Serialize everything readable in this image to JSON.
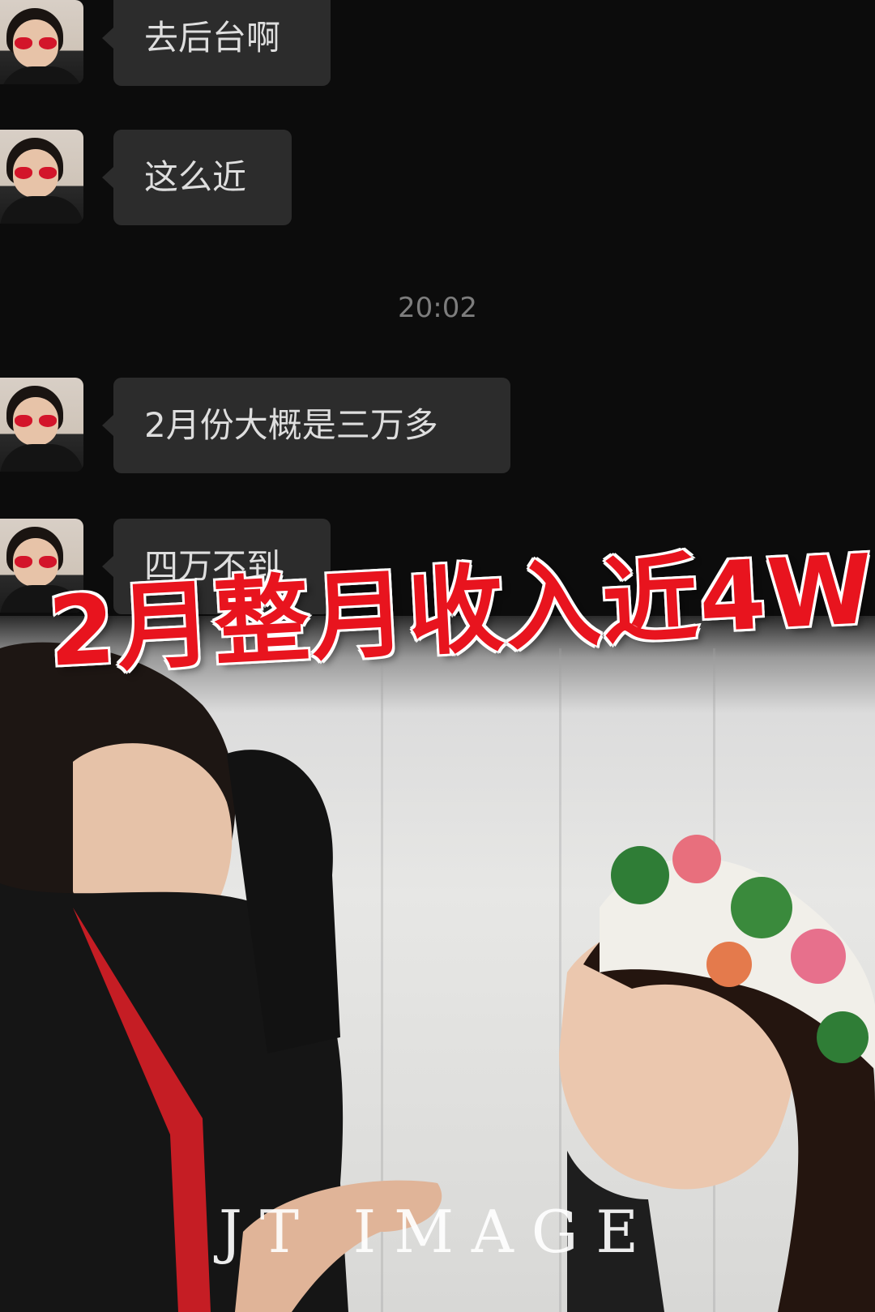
{
  "messages": [
    {
      "text": "去后台啊"
    },
    {
      "text": "这么近"
    },
    {
      "text": "2月份大概是三万多"
    },
    {
      "text": "四万不到"
    }
  ],
  "timestamp": "20:02",
  "headline": "2月整月收入近4W",
  "watermark": "JT  IMAGE",
  "colors": {
    "headline": "#e8141e",
    "bubble": "#2c2c2c",
    "chat_bg": "#0c0c0c"
  }
}
